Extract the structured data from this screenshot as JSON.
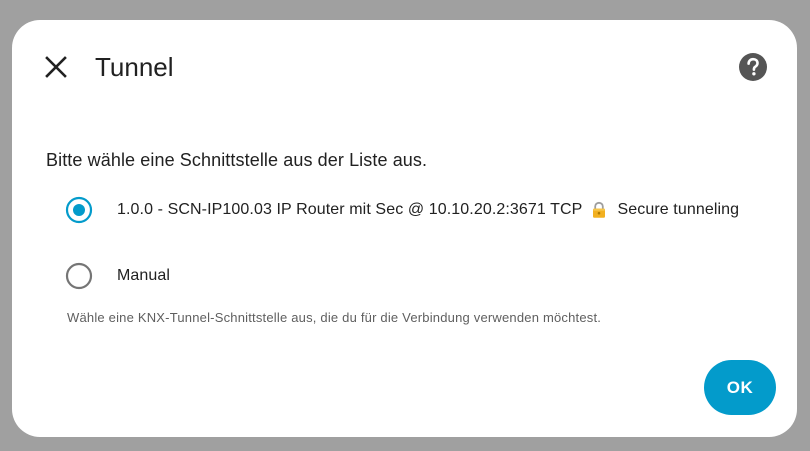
{
  "dialog": {
    "title": "Tunnel",
    "prompt": "Bitte wähle eine Schnittstelle aus der Liste aus.",
    "options": [
      {
        "label": "1.0.0 - SCN-IP100.03 IP Router mit Sec @ 10.10.20.2:3671 TCP",
        "suffix": "Secure tunneling",
        "icon": "lock-icon",
        "selected": true
      },
      {
        "label": "Manual",
        "selected": false
      }
    ],
    "hint": "Wähle eine KNX-Tunnel-Schnittstelle aus, die du für die Verbindung verwenden möchtest.",
    "ok_label": "OK"
  },
  "colors": {
    "accent": "#039bcb",
    "backdrop": "#a0a0a0",
    "text": "#212121",
    "hint_text": "#5f5f5f"
  }
}
